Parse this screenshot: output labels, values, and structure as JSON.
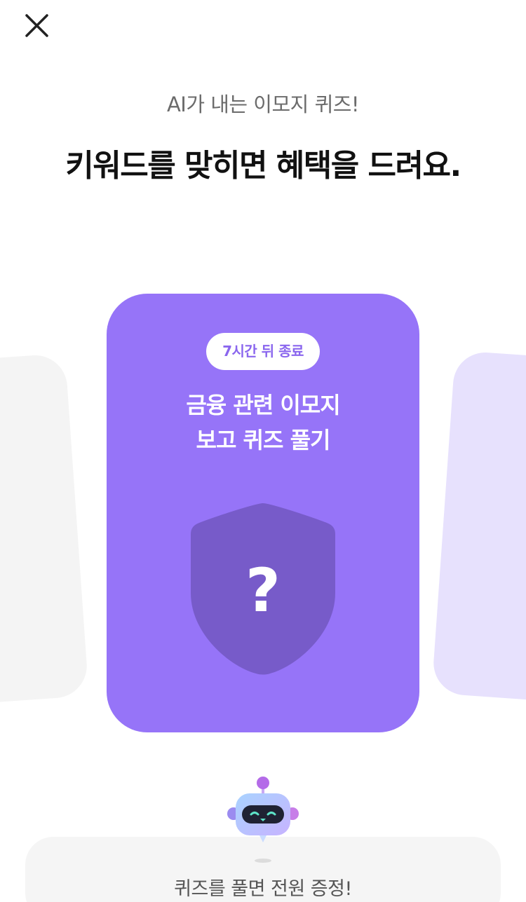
{
  "header": {
    "close_icon": "close-icon"
  },
  "intro": {
    "subtitle": "AI가 내는 이모지 퀴즈!",
    "headline": "키워드를 맞히면 혜택을 드려요."
  },
  "quiz_card": {
    "badge": "7시간 뒤 종료",
    "title_line1": "금융 관련 이모지",
    "title_line2": "보고 퀴즈 풀기",
    "mystery_glyph": "?",
    "icon": "shield-question-icon",
    "color": "#9674f8"
  },
  "side_cards": {
    "left_color": "#f4f4f4",
    "right_color": "#e7e1fd"
  },
  "footer": {
    "mascot_icon": "robot-mascot-icon",
    "message": "퀴즈를 풀면 전원 증정!"
  }
}
